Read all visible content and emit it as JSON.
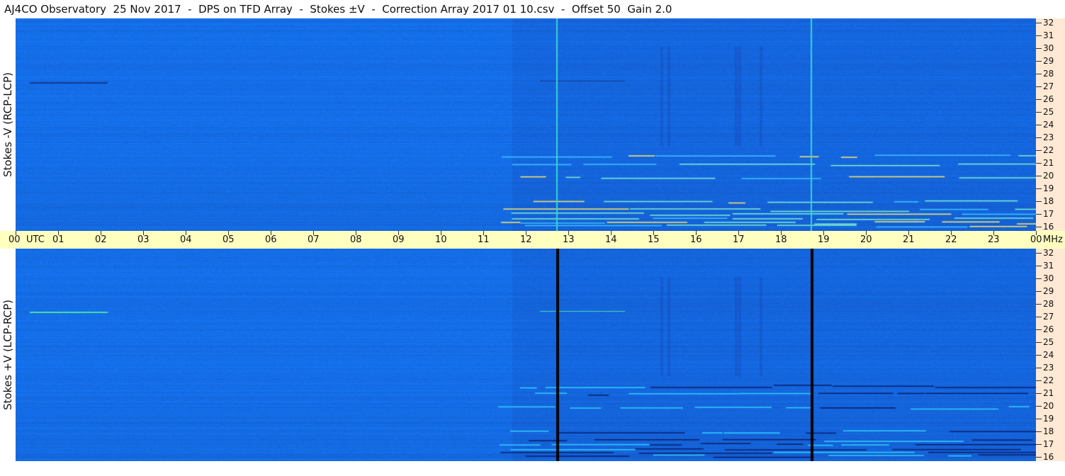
{
  "title": "AJ4CO Observatory  25 Nov 2017  -  DPS on TFD Array  -  Stokes ±V  -  Correction Array 2017 01 10.csv  -  Offset 50  Gain 2.0",
  "top_panel": {
    "label": "Stokes -V (RCP-LCP)"
  },
  "bottom_panel": {
    "label": "Stokes +V (LCP-RCP)"
  },
  "utc_axis": {
    "start_label": "00",
    "start_unit": "UTC",
    "labels": [
      "00",
      "01",
      "02",
      "03",
      "04",
      "05",
      "06",
      "07",
      "08",
      "09",
      "10",
      "11",
      "12",
      "13",
      "14",
      "15",
      "16",
      "17",
      "18",
      "19",
      "20",
      "21",
      "22",
      "23",
      "00"
    ],
    "end_unit": "MHz"
  },
  "freq_axis": {
    "labels": [
      "32",
      "31",
      "30",
      "29",
      "28",
      "27",
      "26",
      "25",
      "24",
      "23",
      "22",
      "21",
      "20",
      "19",
      "18",
      "17",
      "16"
    ]
  },
  "colors": {
    "background_blue": "#1a6ee8",
    "freq_axis_bg": "#ffe8d4",
    "utc_axis_bg": "#ffffc0"
  }
}
